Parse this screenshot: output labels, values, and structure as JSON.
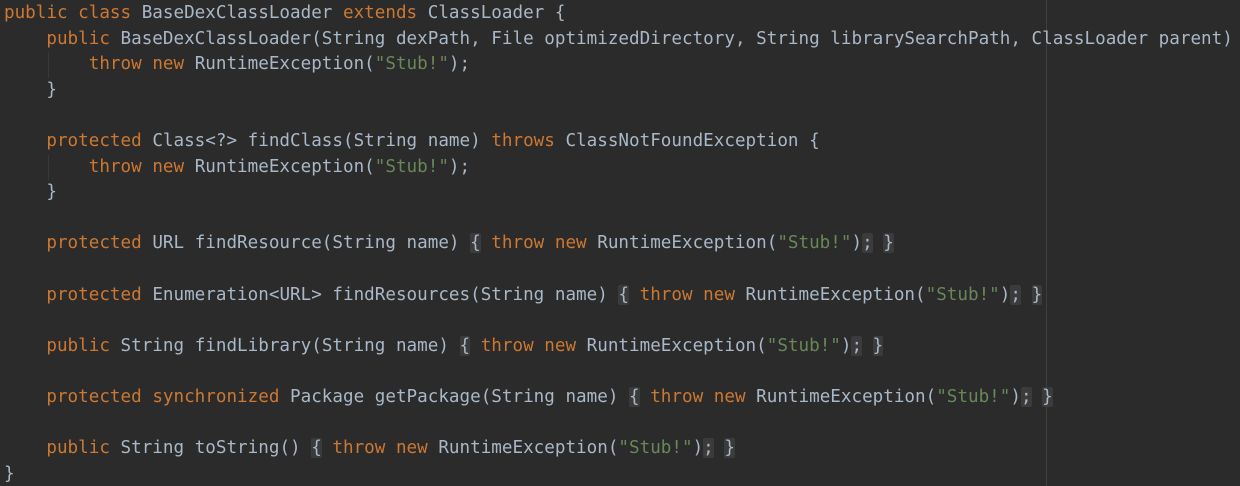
{
  "code": {
    "language": "java",
    "lines": [
      {
        "text": "public class BaseDexClassLoader extends ClassLoader {"
      },
      {
        "text": "    public BaseDexClassLoader(String dexPath, File optimizedDirectory, String librarySearchPath, ClassLoader parent) {"
      },
      {
        "text": "        throw new RuntimeException(\"Stub!\");"
      },
      {
        "text": "    }"
      },
      {
        "text": ""
      },
      {
        "text": "    protected Class<?> findClass(String name) throws ClassNotFoundException {"
      },
      {
        "text": "        throw new RuntimeException(\"Stub!\");"
      },
      {
        "text": "    }"
      },
      {
        "text": ""
      },
      {
        "text": "    protected URL findResource(String name) { throw new RuntimeException(\"Stub!\"); }"
      },
      {
        "text": ""
      },
      {
        "text": "    protected Enumeration<URL> findResources(String name) { throw new RuntimeException(\"Stub!\"); }"
      },
      {
        "text": ""
      },
      {
        "text": "    public String findLibrary(String name) { throw new RuntimeException(\"Stub!\"); }"
      },
      {
        "text": ""
      },
      {
        "text": "    protected synchronized Package getPackage(String name) { throw new RuntimeException(\"Stub!\"); }"
      },
      {
        "text": ""
      },
      {
        "text": "    public String toString() { throw new RuntimeException(\"Stub!\"); }"
      },
      {
        "text": "}"
      }
    ]
  },
  "theme": {
    "background": "#2B2B2B",
    "keyword": "#CC7832",
    "string": "#6A8759",
    "text": "#A9B7C6",
    "folded_block_bg": "#3B3B3B",
    "right_margin_line": "#3E3E3E"
  }
}
